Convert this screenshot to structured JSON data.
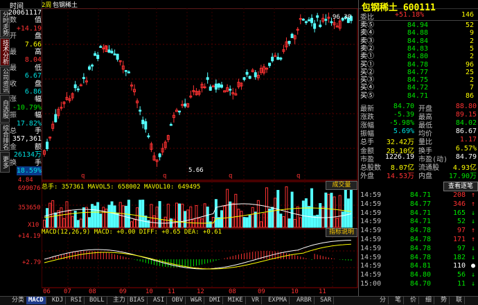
{
  "header": {
    "period": "2周",
    "chart_title": "包钢稀土",
    "title": "包钢稀土 600111"
  },
  "side_tabs": [
    "分时走势",
    "技术分析",
    "公司资讯",
    "自选股",
    "综合排名",
    "更多"
  ],
  "left_panel": {
    "header": "时间",
    "rows": [
      {
        "k": "",
        "v": "20061117"
      },
      {
        "k": "数",
        "v": "值"
      },
      {
        "k": "",
        "v": "+14.19"
      },
      {
        "k": "开",
        "v": "盘"
      },
      {
        "k": "",
        "v": "7.66"
      },
      {
        "k": "最",
        "v": "高"
      },
      {
        "k": "",
        "v": "8.04"
      },
      {
        "k": "最",
        "v": "低"
      },
      {
        "k": "",
        "v": "6.67"
      },
      {
        "k": "收",
        "v": "盘"
      },
      {
        "k": "",
        "v": "6.86"
      },
      {
        "k": "涨",
        "v": "幅"
      },
      {
        "k": "",
        "v": "-10.79%"
      },
      {
        "k": "振",
        "v": "幅"
      },
      {
        "k": "",
        "v": "17.82%"
      },
      {
        "k": "总",
        "v": "手"
      },
      {
        "k": "",
        "v": "357,361"
      },
      {
        "k": "金",
        "v": "额"
      },
      {
        "k": "",
        "v": "26134万"
      },
      {
        "k": "换",
        "v": "手"
      },
      {
        "k": "",
        "v": "18.59%"
      }
    ]
  },
  "price_axis": {
    "high_label": "96.30",
    "low_label": "5.66",
    "bottom_label": "4.84",
    "q_marks": [
      "q",
      "q",
      "q",
      "q",
      "q"
    ]
  },
  "volume_panel": {
    "legend": "总手: 357361  MAVOL5: 658002  MAVOL10: 649495",
    "button": "成交量",
    "labels": [
      "699076",
      "353650",
      "X10"
    ]
  },
  "macd_panel": {
    "legend": "MACD(12,26,9)  MACD: +0.00  DIFF: +0.65  DEA: +0.61",
    "button": "指标说明",
    "labels": [
      "+14.19",
      "+2.79"
    ]
  },
  "x_axis": [
    "06",
    "07",
    "08",
    "09",
    "10",
    "11",
    "12",
    "08",
    "09",
    "10",
    "11"
  ],
  "quote": {
    "ratio_label": "委比",
    "ratio_value": "+51.18%",
    "ratio_diff": "146",
    "sells": [
      {
        "label": "卖⑤",
        "price": "84.94",
        "vol": "52"
      },
      {
        "label": "卖④",
        "price": "84.88",
        "vol": "9"
      },
      {
        "label": "卖③",
        "price": "84.84",
        "vol": "2"
      },
      {
        "label": "卖②",
        "price": "84.83",
        "vol": "5"
      },
      {
        "label": "卖①",
        "price": "84.80",
        "vol": "2"
      }
    ],
    "buys": [
      {
        "label": "买①",
        "price": "84.78",
        "vol": "96"
      },
      {
        "label": "买②",
        "price": "84.77",
        "vol": "25"
      },
      {
        "label": "买③",
        "price": "84.75",
        "vol": "2"
      },
      {
        "label": "买④",
        "price": "84.72",
        "vol": "7"
      },
      {
        "label": "买⑤",
        "price": "84.71",
        "vol": "86"
      }
    ],
    "stats": [
      {
        "k1": "最新",
        "v1": "84.70",
        "k2": "开盘",
        "v2": "88.80"
      },
      {
        "k1": "涨跌",
        "v1": "-5.39",
        "k2": "最高",
        "v2": "89.15"
      },
      {
        "k1": "涨幅",
        "v1": "-5.98%",
        "k2": "最低",
        "v2": "84.02"
      },
      {
        "k1": "振幅",
        "v1": "5.69%",
        "k2": "均价",
        "v2": "86.67"
      },
      {
        "k1": "总手",
        "v1": "32.42万",
        "k2": "量比",
        "v2": "1.17"
      },
      {
        "k1": "金额",
        "v1": "28.10亿",
        "k2": "换手",
        "v2": "6.57%"
      },
      {
        "k1": "市盈",
        "v1": "1226.19",
        "k2": "市盈(动)",
        "v2": "84.79"
      },
      {
        "k1": "总股数",
        "v1": "8.07亿",
        "k2": "流通股",
        "v2": "4.93亿"
      },
      {
        "k1": "外盘",
        "v1": "14.53万",
        "k2": "内盘",
        "v2": "17.90万"
      }
    ],
    "trade_button": "查看逐笔"
  },
  "trades": [
    {
      "t": "14:59",
      "p": "84.71",
      "v": "208",
      "dir": "up"
    },
    {
      "t": "14:59",
      "p": "84.77",
      "v": "346",
      "dir": "up"
    },
    {
      "t": "14:59",
      "p": "84.71",
      "v": "165",
      "dir": "down"
    },
    {
      "t": "14:59",
      "p": "84.71",
      "v": "52",
      "dir": "down"
    },
    {
      "t": "14:59",
      "p": "84.78",
      "v": "97",
      "dir": "up"
    },
    {
      "t": "14:59",
      "p": "84.78",
      "v": "171",
      "dir": "up"
    },
    {
      "t": "14:59",
      "p": "84.78",
      "v": "97",
      "dir": "down"
    },
    {
      "t": "14:59",
      "p": "84.78",
      "v": "182",
      "dir": "down"
    },
    {
      "t": "14:59",
      "p": "84.81",
      "v": "110",
      "dir": "down"
    },
    {
      "t": "14:59",
      "p": "84.80",
      "v": "56",
      "dir": "down"
    },
    {
      "t": "15:00",
      "p": "84.70",
      "v": "11",
      "dir": "down"
    }
  ],
  "bottom_tabs": [
    "分类",
    "MACD",
    "KDJ",
    "RSI",
    "BOLL",
    "主力",
    "BIAS",
    "ASI",
    "OBV",
    "W&R",
    "DMI",
    "MIKE",
    "VR",
    "EXPMA",
    "ARBR",
    "SAR"
  ],
  "right_bottom_tabs": [
    "分",
    "笔",
    "价",
    "细",
    "势",
    "联"
  ]
}
